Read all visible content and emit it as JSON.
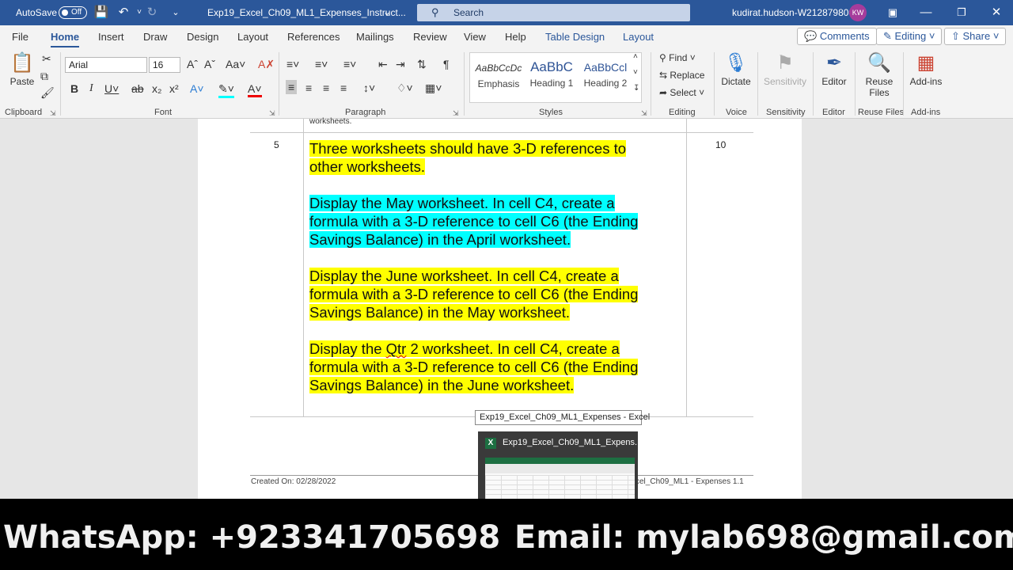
{
  "titlebar": {
    "autosave": "AutoSave",
    "toggle": "Off",
    "doc_title": "Exp19_Excel_Ch09_ML1_Expenses_Instruct...",
    "search": "Search",
    "user": "kudirat.hudson-W212879806",
    "avatar": "KW"
  },
  "tabs": [
    "File",
    "Home",
    "Insert",
    "Draw",
    "Design",
    "Layout",
    "References",
    "Mailings",
    "Review",
    "View",
    "Help",
    "Table Design",
    "Layout"
  ],
  "ribbon_buttons": {
    "comments": "Comments",
    "editing": "Editing",
    "share": "Share"
  },
  "ribbon": {
    "clipboard": {
      "paste": "Paste",
      "label": "Clipboard"
    },
    "font": {
      "name": "Arial",
      "size": "16",
      "label": "Font"
    },
    "paragraph": {
      "label": "Paragraph"
    },
    "styles": {
      "label": "Styles",
      "items": [
        {
          "preview": "AaBbCcDc",
          "name": "Emphasis"
        },
        {
          "preview": "AaBbC",
          "name": "Heading 1"
        },
        {
          "preview": "AaBbCcl",
          "name": "Heading 2"
        }
      ]
    },
    "editing": {
      "find": "Find",
      "replace": "Replace",
      "select": "Select",
      "label": "Editing"
    },
    "voice": {
      "dictate": "Dictate",
      "label": "Voice"
    },
    "sensitivity": {
      "button": "Sensitivity",
      "label": "Sensitivity"
    },
    "editor": {
      "button": "Editor",
      "label": "Editor"
    },
    "reuse": {
      "button_line1": "Reuse",
      "button_line2": "Files",
      "label": "Reuse Files"
    },
    "addins": {
      "button": "Add-ins",
      "label": "Add-ins"
    }
  },
  "document": {
    "prev_cell_text": "worksheets.",
    "row_number": "5",
    "points": "10",
    "paragraphs": [
      "Three worksheets should have 3-D references to other worksheets.",
      "Display the May worksheet. In cell C4, create a formula with a 3-D reference to cell C6 (the Ending Savings Balance) in the April worksheet.",
      "Display the June worksheet. In cell C4, create a formula with a 3-D reference to cell C6 (the Ending Savings Balance) in the May worksheet.",
      {
        "before": "Display the ",
        "flagged": "Qtr",
        "after": " 2 worksheet. In cell C4, create a formula with a 3-D reference to cell C6 (the Ending Savings Balance) in the June worksheet."
      }
    ],
    "footer_left": "Created On: 02/28/2022",
    "footer_right": "cel_Ch09_ML1 - Expenses 1.1"
  },
  "taskbar_preview": {
    "tooltip": "Exp19_Excel_Ch09_ML1_Expenses - Excel",
    "title": "Exp19_Excel_Ch09_ML1_Expens...",
    "app_icon": "X"
  },
  "banner": {
    "whatsapp": "WhatsApp: +923341705698",
    "email": "Email: mylab698@gmail.com"
  },
  "colors": {
    "word_blue": "#2b579a",
    "highlight_yellow": "#ffff00",
    "highlight_cyan": "#00ffff",
    "excel_green": "#1d6f42"
  }
}
